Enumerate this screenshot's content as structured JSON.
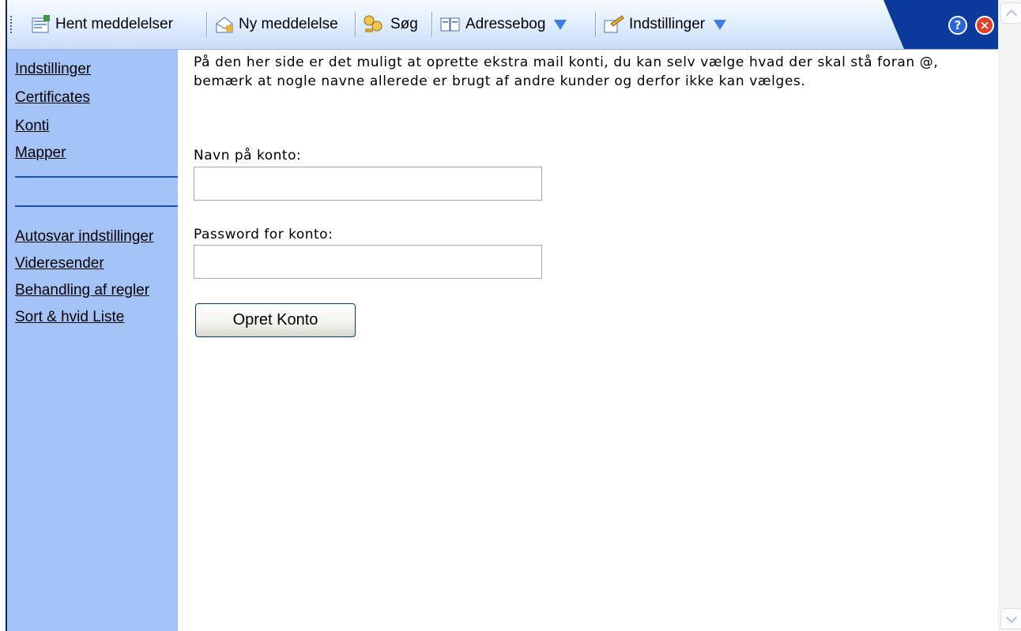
{
  "toolbar": {
    "items": [
      {
        "label": "Hent meddelelser",
        "icon": "get-messages-icon"
      },
      {
        "label": "Ny meddelelse",
        "icon": "new-message-icon"
      },
      {
        "label": "Søg",
        "icon": "search-icon"
      },
      {
        "label": "Adressebog",
        "icon": "address-book-icon"
      },
      {
        "label": "Indstillinger",
        "icon": "settings-icon"
      }
    ],
    "help_symbol": "?",
    "close_symbol": "×"
  },
  "sidebar": {
    "top_links": [
      "Indstillinger",
      "Certificates",
      "Konti",
      "Mapper"
    ],
    "bottom_links": [
      "Autosvar indstillinger",
      "Videresender",
      "Behandling af regler",
      "Sort & hvid Liste"
    ]
  },
  "main": {
    "intro": "På den her side er det muligt at oprette ekstra mail konti, du kan selv vælge hvad der skal stå foran @, bemærk at nogle navne allerede er brugt af andre kunder og derfor ikke kan vælges.",
    "account_name_label": "Navn på konto:",
    "account_name_value": "",
    "password_label": "Password for konto:",
    "password_value": "",
    "submit_label": "Opret Konto"
  },
  "colors": {
    "sidebar_bg": "#a4c3f6",
    "toolbar_accent": "#0a3a9b",
    "help_button": "#2a64d6",
    "close_button": "#e0402a"
  }
}
